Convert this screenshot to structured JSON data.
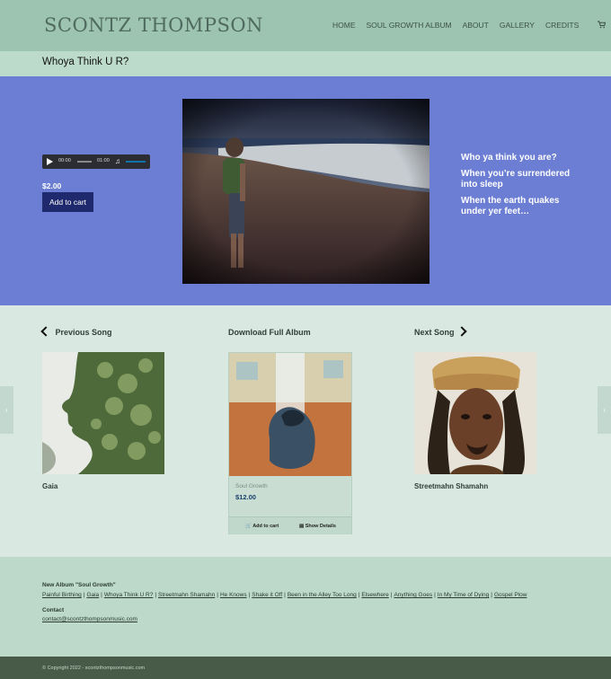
{
  "header": {
    "logo": "SCONTZ THOMPSON",
    "nav": [
      "HOME",
      "SOUL GROWTH ALBUM",
      "ABOUT",
      "GALLERY",
      "CREDITS"
    ],
    "cart_icon": "shopping-cart-icon"
  },
  "page_title": "Whoya Think U R?",
  "player": {
    "current_time": "00:00",
    "duration": "01:00"
  },
  "product": {
    "price": "$2.00",
    "add_to_cart": "Add to cart"
  },
  "lyrics": [
    "Who ya think you are?",
    "When you’re surrendered into sleep",
    "When the earth quakes under yer feet…"
  ],
  "song_nav": {
    "previous_label": "Previous Song",
    "previous_title": "Gaia",
    "album_label": "Download Full Album",
    "next_label": "Next Song",
    "next_title": "Streetmahn Shamahn"
  },
  "album_card": {
    "genre": "Soul Growth",
    "price": "$12.00",
    "add_to_cart": "Add to cart",
    "show_details": "Show Details"
  },
  "footer": {
    "album_heading": "New Album \"Soul Growth\"",
    "tracks": [
      "Painful Birthing",
      "Gaia",
      "Whoya Think U R?",
      "Streetmahn Shamahn",
      "He Knows",
      "Shake it Off",
      "Been in the Alley Too Long",
      "Elsewhere",
      "Anything Goes",
      "In My Time of Dying",
      "Gospel Plow"
    ],
    "contact_heading": "Contact",
    "email": "contact@scontzthompsonmusic.com"
  },
  "copyright": "© Copyright 2022 - scontzthompsonmusic.com",
  "colors": {
    "header": "#9dc3b1",
    "hero": "#6b7ed3",
    "button": "#1f2a6e",
    "footer": "#bcd9c9",
    "bottom_bar": "#475b48"
  }
}
